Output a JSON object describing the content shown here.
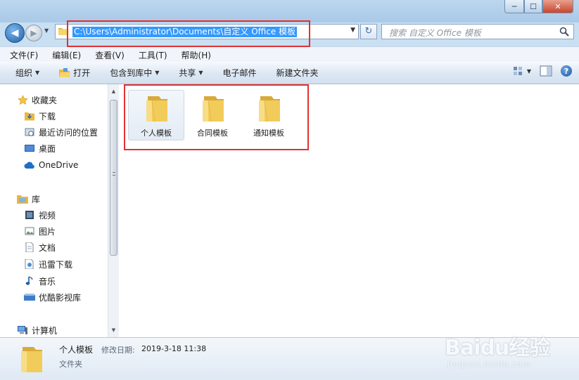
{
  "window": {
    "controls": {
      "minimize": "─",
      "maximize": "☐",
      "close": "✕"
    }
  },
  "navigation": {
    "back_glyph": "◀",
    "forward_glyph": "▶",
    "recent_glyph": "▼",
    "address": "C:\\Users\\Administrator\\Documents\\自定义 Office 模板",
    "address_dropdown": "▼",
    "refresh_glyph": "↻",
    "search_placeholder": "搜索 自定义 Office 模板"
  },
  "menu": [
    "文件(F)",
    "编辑(E)",
    "查看(V)",
    "工具(T)",
    "帮助(H)"
  ],
  "toolbar": {
    "organize": "组织",
    "open": "打开",
    "include_in_library": "包含到库中",
    "share": "共享",
    "email": "电子邮件",
    "new_folder": "新建文件夹",
    "help": "?"
  },
  "sidebar": {
    "favorites": {
      "label": "收藏夹",
      "items": [
        "下载",
        "最近访问的位置",
        "桌面",
        "OneDrive"
      ]
    },
    "libraries": {
      "label": "库",
      "items": [
        "视频",
        "图片",
        "文档",
        "迅雷下载",
        "音乐",
        "优酷影视库"
      ]
    },
    "computer": {
      "label": "计算机"
    }
  },
  "files": [
    {
      "name": "个人模板",
      "selected": true
    },
    {
      "name": "合同模板",
      "selected": false
    },
    {
      "name": "通知模板",
      "selected": false
    }
  ],
  "details": {
    "name": "个人模板",
    "modified_label": "修改日期:",
    "modified_value": "2019-3-18 11:38",
    "type": "文件夹"
  },
  "watermark": {
    "brand": "Baidu经验",
    "url": "jingyan.baidu.com"
  },
  "colors": {
    "selection": "#3399ff",
    "highlight": "#e33131",
    "folder": "#f2cc5a"
  }
}
